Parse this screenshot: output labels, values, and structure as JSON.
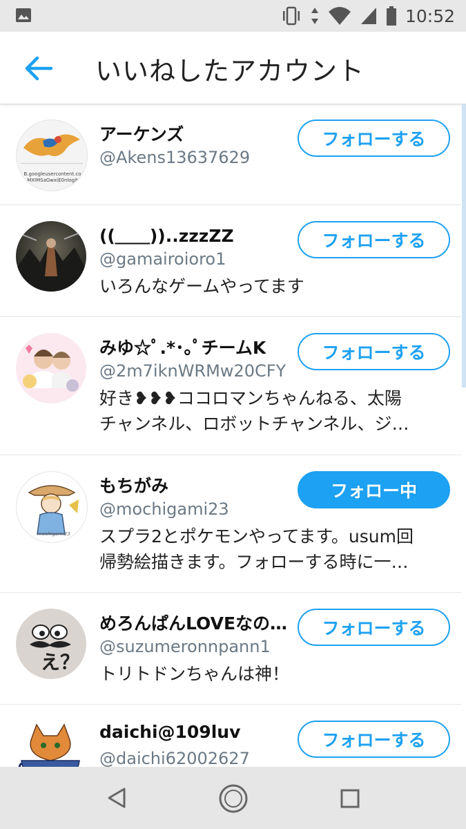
{
  "status_bar": {
    "time": "10:52"
  },
  "header": {
    "title": "いいねしたアカウント"
  },
  "accounts": [
    {
      "name": "アーケンズ",
      "handle": "@Akens13637629",
      "bio": [],
      "button": "フォローする",
      "following": false
    },
    {
      "name": "((＿＿))..zzzZZ",
      "handle": "@gamairoioro1",
      "bio": [
        "いろんなゲームやってます"
      ],
      "button": "フォローする",
      "following": false
    },
    {
      "name": "みゆ☆ﾟ.*･｡ﾟチームK",
      "handle": "@2m7iknWRMw20CFY",
      "bio": [
        "好き❥❥❥ココロマンちゃんねる、太陽",
        "チャンネル、ロボットチャンネル、ジ…"
      ],
      "button": "フォローする",
      "following": false
    },
    {
      "name": "もちがみ",
      "handle": "@mochigami23",
      "bio": [
        "スプラ2とポケモンやってます。usum回",
        "帰勢絵描きます。フォローする時に一…"
      ],
      "button": "フォロー中",
      "following": true
    },
    {
      "name": "めろんぱんLOVEなの…",
      "handle": "@suzumeronnpann1",
      "bio": [
        "トリトドンちゃんは神！"
      ],
      "button": "フォローする",
      "following": false
    },
    {
      "name": "daichi@109luv",
      "handle": "@daichi62002627",
      "bio": [],
      "button": "フォローする",
      "following": false
    }
  ],
  "avatar_1_caption": {
    "line1": "B.googleusercontent.co",
    "line2": "MXIMSaGwxiE0nlogit"
  },
  "avatar_4_signature": "mochigami23",
  "avatar_5_text": "え？",
  "colors": {
    "accent": "#1da1f2",
    "handle": "#6b7985",
    "statusbar": "#e8e8e8",
    "navbar": "#e6e6e6"
  },
  "icons": {
    "back": "arrow-left-icon",
    "nav_back": "triangle-back-icon",
    "nav_home": "circle-home-icon",
    "nav_recent": "square-recents-icon"
  }
}
